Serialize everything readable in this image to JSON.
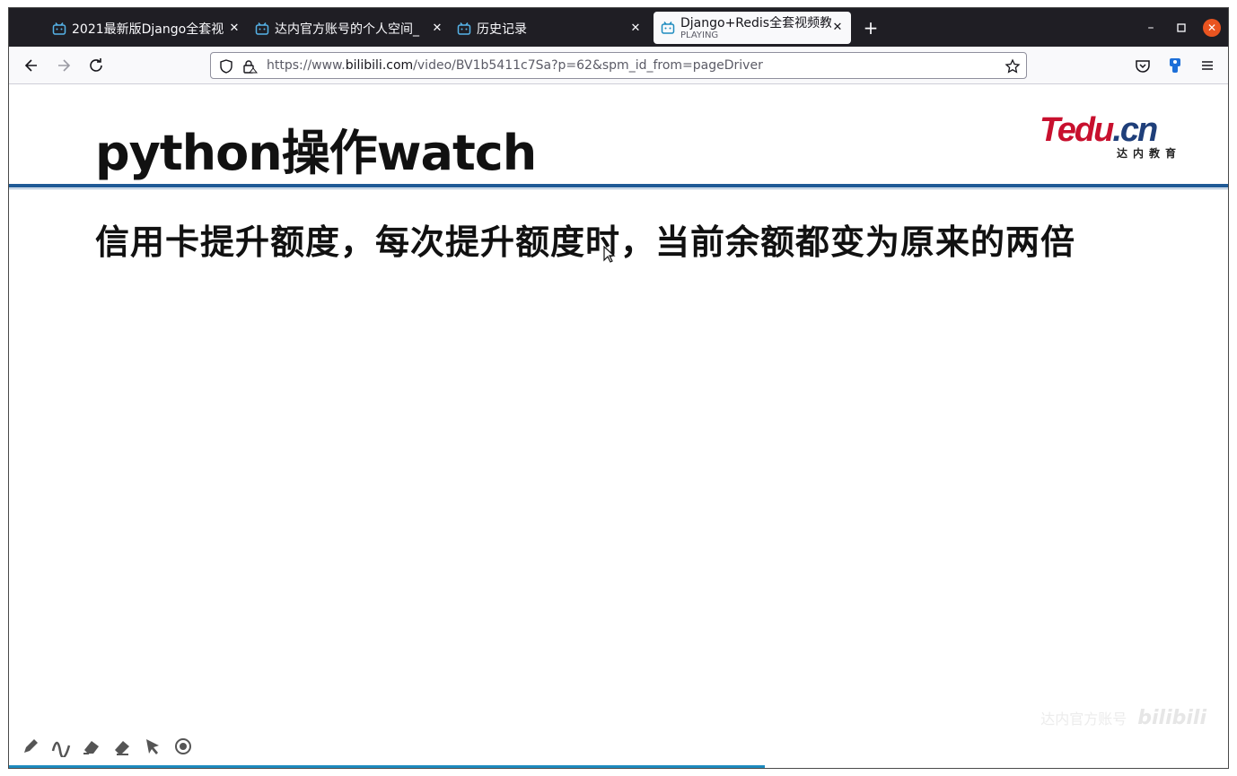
{
  "browser": {
    "tabs": [
      {
        "label": "2021最新版Django全套视",
        "active": false
      },
      {
        "label": "达内官方账号的个人空间_",
        "active": false
      },
      {
        "label": "历史记录",
        "active": false
      },
      {
        "label": "Django+Redis全套视频教",
        "sub": "PLAYING",
        "active": true
      }
    ],
    "url": {
      "prefix": "https://www.",
      "domain": "bilibili.com",
      "path": "/video/BV1b5411c7Sa?p=62&spm_id_from=pageDriver"
    },
    "accent_color": "#e95420"
  },
  "slide": {
    "title": "python操作watch",
    "logo_main": "Tedu",
    "logo_suffix": ".cn",
    "logo_sub": "达内教育",
    "body_text": "信用卡提升额度，每次提升额度时，当前余额都变为原来的两倍",
    "rule_color": "#1f5a96"
  },
  "player": {
    "tools": [
      "pencil-icon",
      "curve-icon",
      "highlighter-icon",
      "eraser-icon",
      "pointer-icon",
      "record-icon"
    ],
    "watermark_text": "达内官方账号",
    "watermark_logo": "bilibili",
    "progress_fraction": 0.62
  }
}
